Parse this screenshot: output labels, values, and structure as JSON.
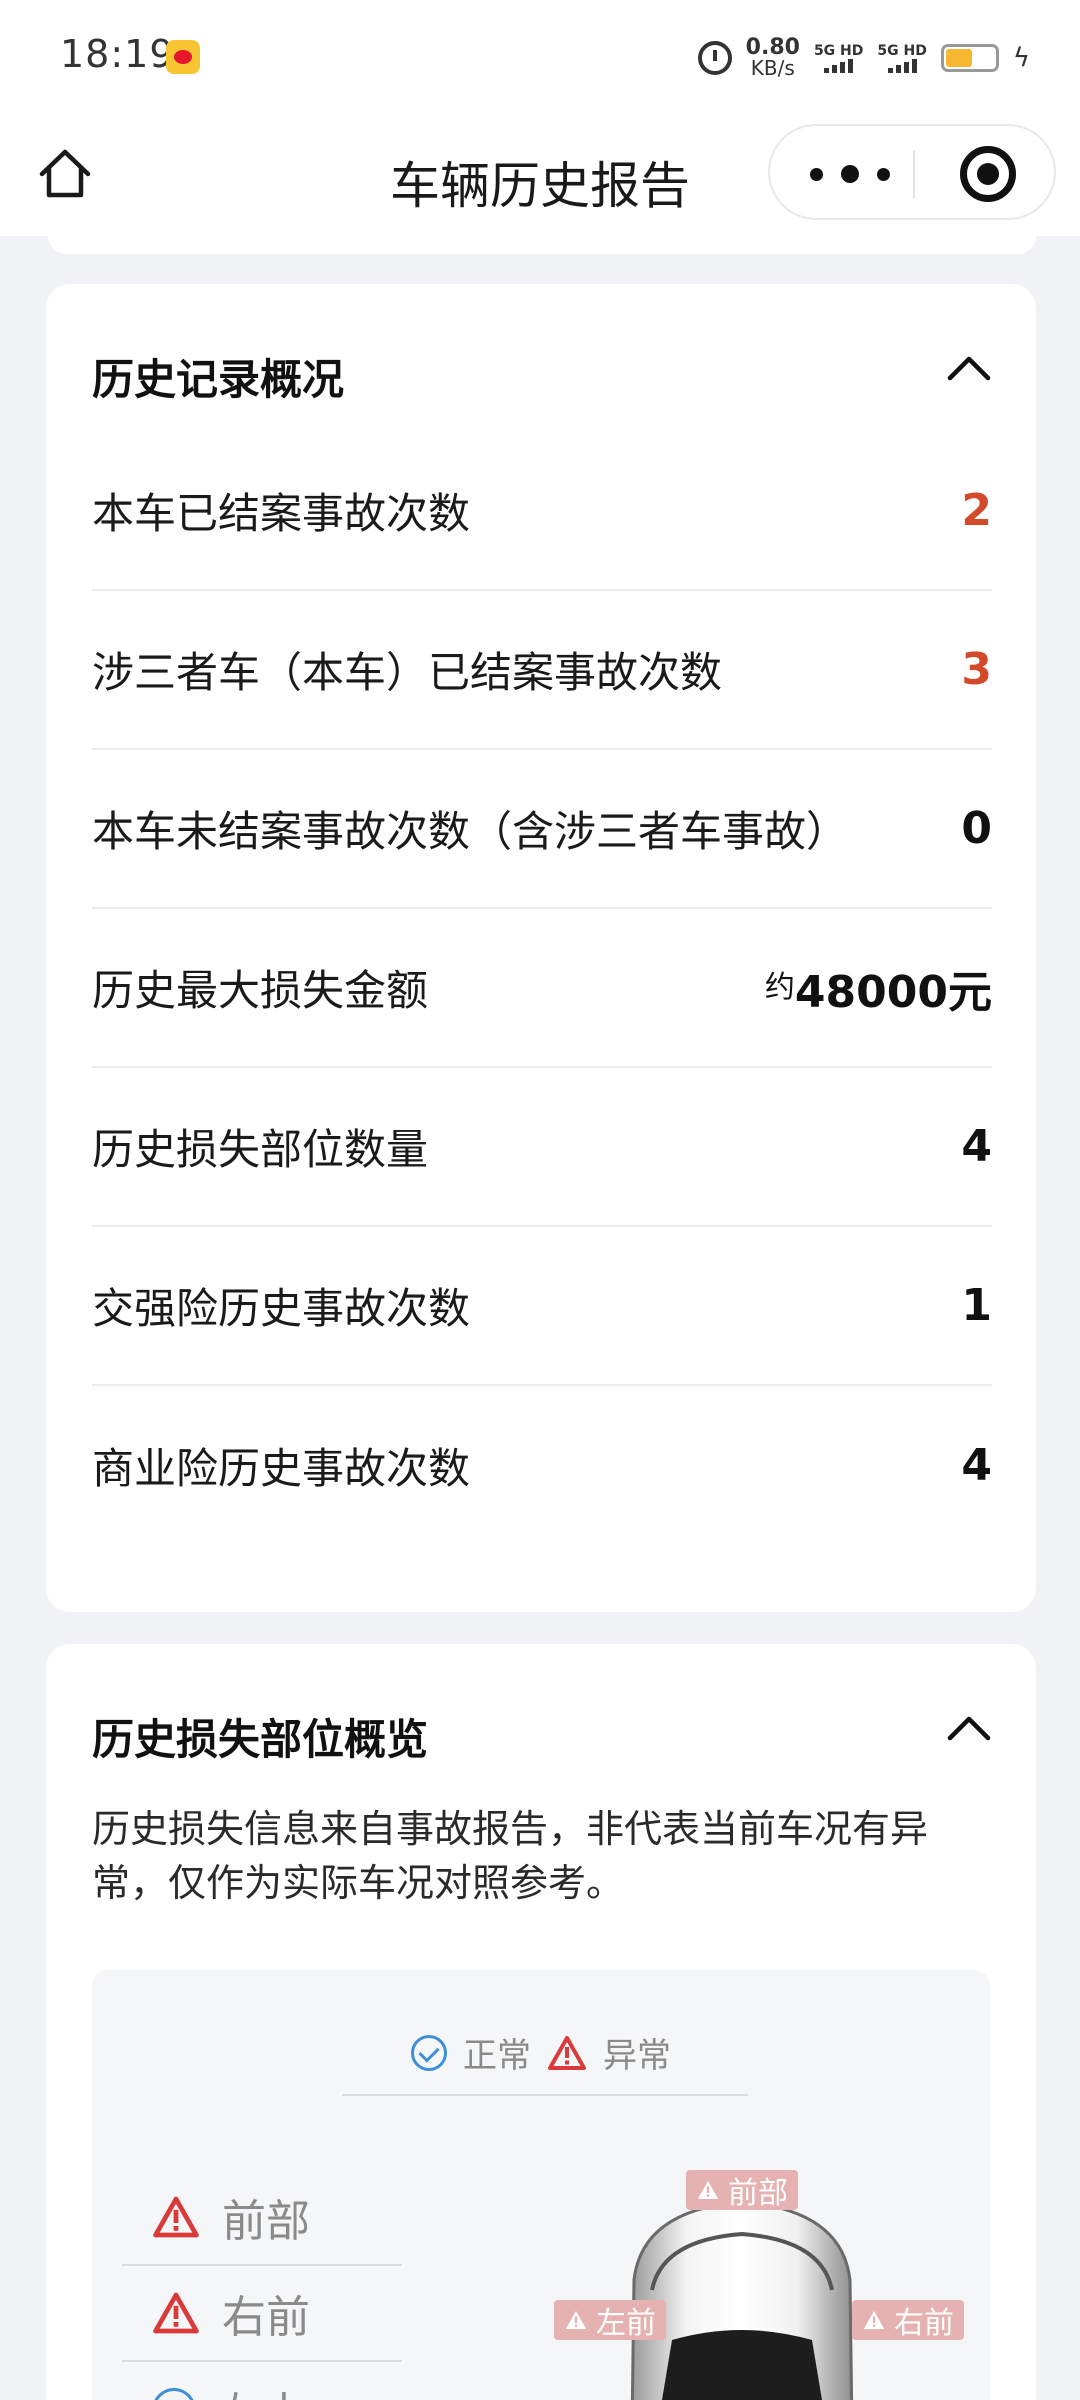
{
  "status_bar": {
    "time": "18:19",
    "net_speed_value": "0.80",
    "net_speed_unit": "KB/s",
    "sim1": "5G HD",
    "sim2": "5G HD",
    "battery_level": 0.55
  },
  "nav": {
    "title": "车辆历史报告"
  },
  "history_overview": {
    "title": "历史记录概况",
    "rows": [
      {
        "label": "本车已结案事故次数",
        "value": "2"
      },
      {
        "label": "涉三者车（本车）已结案事故次数",
        "value": "3"
      },
      {
        "label": "本车未结案事故次数（含涉三者车事故）",
        "value": "0"
      },
      {
        "label": "历史最大损失金额",
        "prefix": "约",
        "value": "48000元"
      },
      {
        "label": "历史损失部位数量",
        "value": "4"
      },
      {
        "label": "交强险历史事故次数",
        "value": "1"
      },
      {
        "label": "商业险历史事故次数",
        "value": "4"
      }
    ]
  },
  "damage_overview": {
    "title": "历史损失部位概览",
    "description": "历史损失信息来自事故报告，非代表当前车况有异常，仅作为实际车况对照参考。",
    "legend": {
      "normal": "正常",
      "abnormal": "异常"
    },
    "parts": [
      "前部",
      "右前",
      "左中"
    ],
    "car_tags": [
      "前部",
      "左前",
      "右前"
    ]
  },
  "colors": {
    "accent_red": "#d34a2a",
    "warn_red": "#d93a3a",
    "normal_blue": "#3f8fd6"
  }
}
